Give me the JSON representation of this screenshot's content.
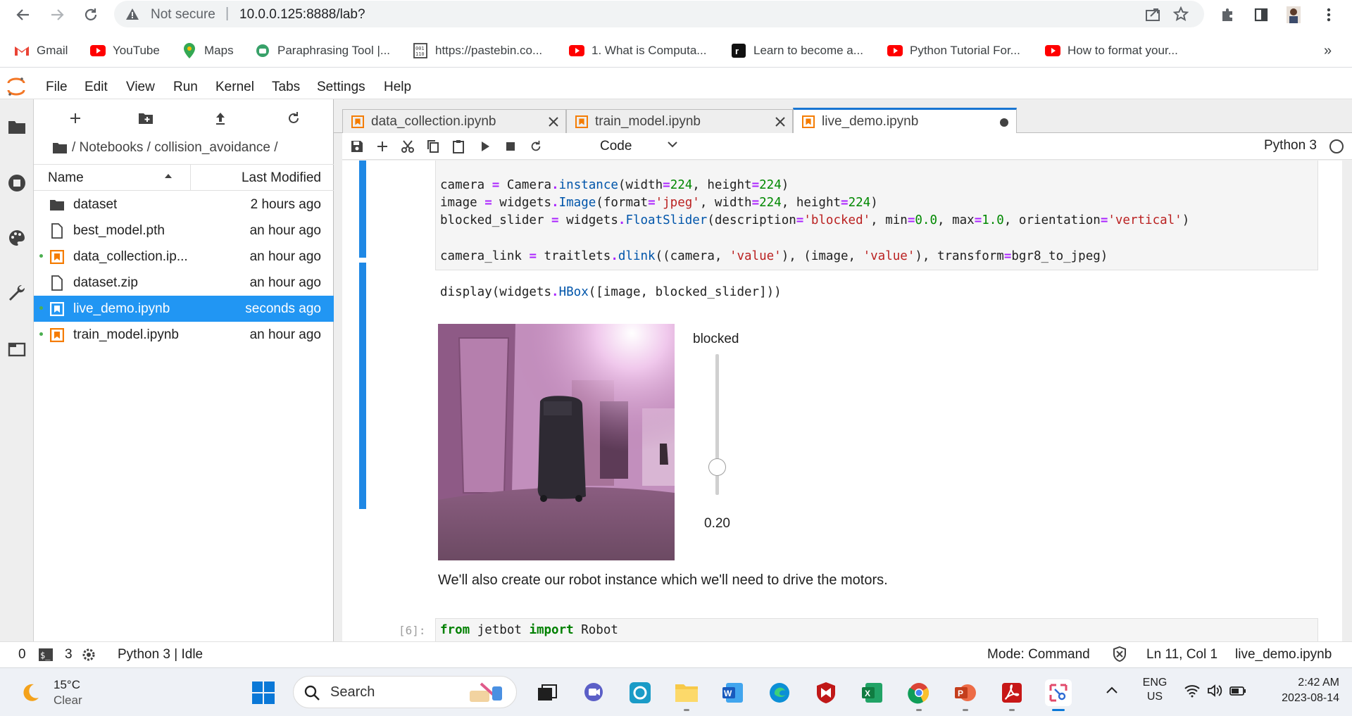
{
  "browser": {
    "security_label": "Not secure",
    "url": "10.0.0.125:8888/lab?"
  },
  "bookmarks": [
    {
      "label": "Gmail",
      "icon": "gmail-icon"
    },
    {
      "label": "YouTube",
      "icon": "youtube-icon"
    },
    {
      "label": "Maps",
      "icon": "maps-icon"
    },
    {
      "label": "Paraphrasing Tool |...",
      "icon": "paraphrase-icon"
    },
    {
      "label": "https://pastebin.co...",
      "icon": "pastebin-icon"
    },
    {
      "label": "1. What is Computa...",
      "icon": "youtube-icon"
    },
    {
      "label": "Learn to become a...",
      "icon": "r-icon"
    },
    {
      "label": "Python Tutorial For...",
      "icon": "youtube-icon"
    },
    {
      "label": "How to format your...",
      "icon": "youtube-icon"
    }
  ],
  "menu": [
    "File",
    "Edit",
    "View",
    "Run",
    "Kernel",
    "Tabs",
    "Settings",
    "Help"
  ],
  "filebrowser": {
    "breadcrumb": "/ Notebooks / collision_avoidance /",
    "col_name": "Name",
    "col_modified": "Last Modified",
    "files": [
      {
        "name": "dataset",
        "modified": "2 hours ago",
        "type": "folder"
      },
      {
        "name": "best_model.pth",
        "modified": "an hour ago",
        "type": "file"
      },
      {
        "name": "data_collection.ip...",
        "modified": "an hour ago",
        "type": "notebook"
      },
      {
        "name": "dataset.zip",
        "modified": "an hour ago",
        "type": "file"
      },
      {
        "name": "live_demo.ipynb",
        "modified": "seconds ago",
        "type": "notebook"
      },
      {
        "name": "train_model.ipynb",
        "modified": "an hour ago",
        "type": "notebook"
      }
    ]
  },
  "tabs": [
    {
      "label": "data_collection.ipynb"
    },
    {
      "label": "train_model.ipynb"
    },
    {
      "label": "live_demo.ipynb"
    }
  ],
  "toolbar": {
    "cell_type": "Code",
    "kernel": "Python 3"
  },
  "code_lines": [
    "camera = Camera.instance(width=224, height=224)",
    "image = widgets.Image(format='jpeg', width=224, height=224)",
    "blocked_slider = widgets.FloatSlider(description='blocked', min=0.0, max=1.0, orientation='vertical')",
    "",
    "camera_link = traitlets.dlink((camera, 'value'), (image, 'value'), transform=bgr8_to_jpeg)",
    "",
    "display(widgets.HBox([image, blocked_slider]))"
  ],
  "slider": {
    "label": "blocked",
    "value_text": "0.20",
    "value": 0.2
  },
  "markdown_text": "We'll also create our robot instance which we'll need to drive the motors.",
  "next_cell": {
    "prompt": "[6]:",
    "code": "from jetbot import Robot"
  },
  "statusbar": {
    "zero": "0",
    "terminals": "3",
    "kernel_state": "Python 3 | Idle",
    "mode": "Mode: Command",
    "cursor": "Ln 11, Col 1",
    "file": "live_demo.ipynb"
  },
  "taskbar": {
    "weather_temp": "15°C",
    "weather_desc": "Clear",
    "search_label": "Search",
    "lang1": "ENG",
    "lang2": "US",
    "time": "2:42 AM",
    "date": "2023-08-14"
  },
  "colors": {
    "accent": "#1e88e5",
    "selected_row": "#2196f3",
    "notebook_icon": "#f57c00"
  }
}
